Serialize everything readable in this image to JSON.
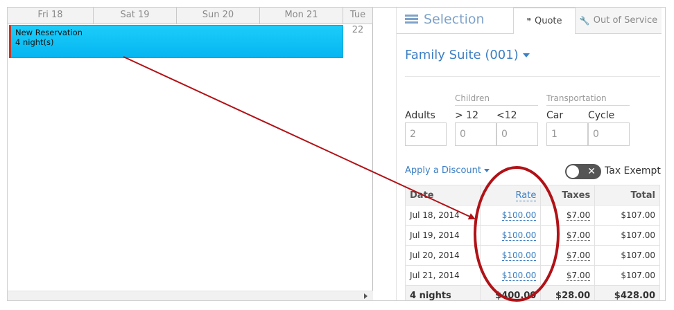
{
  "calendar": {
    "days": [
      "Fri 18",
      "Sat 19",
      "Sun 20",
      "Mon 21",
      "Tue 22"
    ],
    "reservation": {
      "title": "New Reservation",
      "nights": "4 night(s)"
    }
  },
  "panel": {
    "tabs": {
      "selection": "Selection",
      "quote": "Quote",
      "out_of_service": "Out of Service"
    },
    "room_title": "Family Suite (001)",
    "groups": {
      "children": "Children",
      "transportation": "Transportation"
    },
    "fields": {
      "adults": {
        "label": "Adults",
        "value": "2"
      },
      "children_over12": {
        "label": "> 12",
        "value": "0"
      },
      "children_under12": {
        "label": "<12",
        "value": "0"
      },
      "car": {
        "label": "Car",
        "value": "1"
      },
      "cycle": {
        "label": "Cycle",
        "value": "0"
      }
    },
    "discount_label": "Apply a Discount",
    "tax_exempt_label": "Tax Exempt",
    "table": {
      "headers": {
        "date": "Date",
        "rate": "Rate",
        "taxes": "Taxes",
        "total": "Total"
      },
      "rows": [
        {
          "date": "Jul 18, 2014",
          "rate": "$100.00",
          "taxes": "$7.00",
          "total": "$107.00"
        },
        {
          "date": "Jul 19, 2014",
          "rate": "$100.00",
          "taxes": "$7.00",
          "total": "$107.00"
        },
        {
          "date": "Jul 20, 2014",
          "rate": "$100.00",
          "taxes": "$7.00",
          "total": "$107.00"
        },
        {
          "date": "Jul 21, 2014",
          "rate": "$100.00",
          "taxes": "$7.00",
          "total": "$107.00"
        }
      ],
      "footer": {
        "nights": "4 nights",
        "rate": "$400.00",
        "taxes": "$28.00",
        "total": "$428.00"
      }
    }
  },
  "colors": {
    "accent": "#3c7fc4",
    "reservation": "#05b6f1",
    "annotation": "#b01217"
  }
}
